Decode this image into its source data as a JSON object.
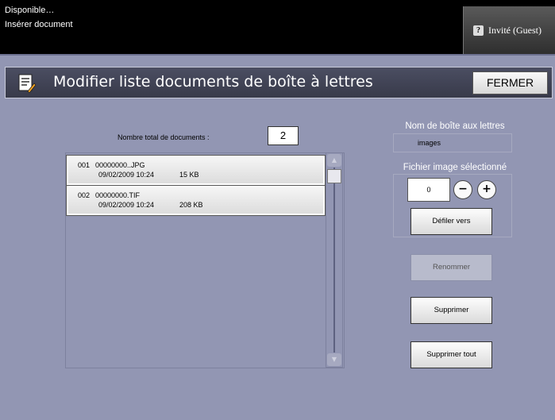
{
  "status": {
    "line1": "Disponible…",
    "line2": "Insérer document"
  },
  "user": {
    "label": "Invité (Guest)",
    "icon": "user-key-icon"
  },
  "header": {
    "title": "Modifier liste documents de boîte à lettres",
    "icon": "document-edit-icon",
    "close_label": "FERMER"
  },
  "documents": {
    "total_label": "Nombre total de documents :",
    "total_value": "2",
    "items": [
      {
        "number": "001",
        "name": "00000000..JPG",
        "datetime": "09/02/2009 10:24",
        "size": "15 KB"
      },
      {
        "number": "002",
        "name": "00000000.TIF",
        "datetime": "09/02/2009 10:24",
        "size": "208 KB"
      }
    ]
  },
  "mailbox": {
    "label": "Nom de boîte aux lettres",
    "value": "images"
  },
  "selected_image": {
    "label": "Fichier image sélectionné",
    "value": "0",
    "minus": "−",
    "plus": "+",
    "scroll_label": "Défiler vers"
  },
  "actions": {
    "rename": "Renommer",
    "delete": "Supprimer",
    "delete_all": "Supprimer tout"
  }
}
